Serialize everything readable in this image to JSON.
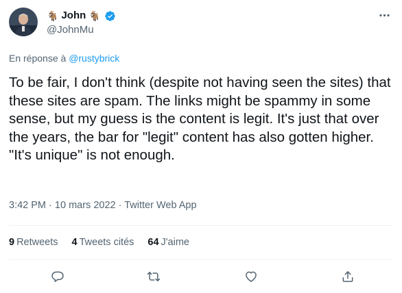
{
  "author": {
    "display_name": "John",
    "name_emoji_left": "🐐",
    "name_emoji_right": "🐐",
    "handle": "@JohnMu",
    "verified": true
  },
  "reply_to": {
    "prefix": "En réponse à",
    "mention": "@rustybrick"
  },
  "tweet": {
    "text": "To be fair, I don't think (despite not having seen the sites) that these sites are spam. The links might be spammy in some sense, but my guess is the content is legit. It's just that over the years, the bar for \"legit\" content has also gotten higher. \"It's unique\" is not enough.",
    "time": "3:42 PM",
    "separator": "·",
    "date": "10 mars 2022",
    "source": "Twitter Web App"
  },
  "stats": {
    "retweets_count": "9",
    "retweets_label": "Retweets",
    "quotes_count": "4",
    "quotes_label": "Tweets cités",
    "likes_count": "64",
    "likes_label": "J'aime"
  },
  "icons": {
    "more": "more-horizontal-icon",
    "reply": "reply-icon",
    "retweet": "retweet-icon",
    "like": "heart-icon",
    "share": "share-icon",
    "verified": "verified-badge-icon"
  },
  "colors": {
    "accent": "#1d9bf0",
    "secondary_text": "#536471",
    "primary_text": "#0f1419",
    "divider": "#eff3f4"
  }
}
